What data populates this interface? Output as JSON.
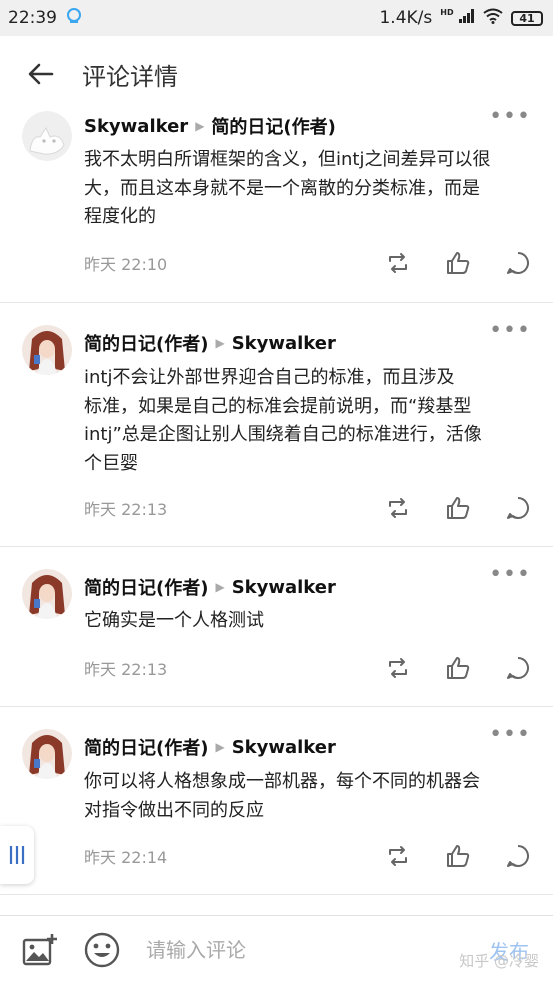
{
  "status_bar": {
    "time": "22:39",
    "speed": "1.4K/s",
    "network": "HD",
    "battery": "41"
  },
  "header": {
    "title": "评论详情"
  },
  "comments": [
    {
      "author": "Skywalker",
      "reply_to": "简的日记(作者)",
      "lines": [
        "我不太明白所谓框架的含义，但intj之间差异可以很",
        "大，而且这本身就不是一个离散的分类标准，而是",
        "程度化的"
      ],
      "time": "昨天 22:10"
    },
    {
      "author": "简的日记(作者)",
      "reply_to": "Skywalker",
      "lines": [
        "intj不会让外部世界迎合自己的标准，而且涉及",
        "标准，如果是自己的标准会提前说明，而“羧基型",
        "intj”总是企图让别人围绕着自己的标准进行，活像",
        "个巨婴"
      ],
      "time": "昨天 22:13"
    },
    {
      "author": "简的日记(作者)",
      "reply_to": "Skywalker",
      "lines": [
        "它确实是一个人格测试"
      ],
      "time": "昨天 22:13"
    },
    {
      "author": "简的日记(作者)",
      "reply_to": "Skywalker",
      "lines": [
        "你可以将人格想象成一部机器，每个不同的机器会",
        "对指令做出不同的反应"
      ],
      "time": "昨天 22:14"
    }
  ],
  "more_label": "•••",
  "input": {
    "placeholder": "请输入评论",
    "send_label": "发布"
  },
  "watermark": "知乎 @冷婴",
  "colors": {
    "accent": "#9fc3f0",
    "divider": "#e6e6e6",
    "meta_text": "#999999"
  },
  "icons": [
    "back-arrow-icon",
    "share-icon",
    "like-icon",
    "comment-icon",
    "add-image-icon",
    "emoji-icon",
    "menu-lines-icon"
  ]
}
